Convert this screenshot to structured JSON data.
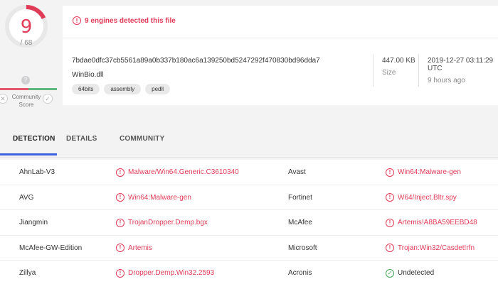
{
  "score": {
    "detections": "9",
    "total": "/ 68",
    "community_label": "Community Score",
    "community_help": "?"
  },
  "summary": {
    "detect_message": "9 engines detected this file",
    "hash": "7bdae0dfc37cb5561a89a0b337b180ac6a139250bd5247292f470830bd96dda7",
    "filename": "WinBio.dll",
    "tags": [
      "64bits",
      "assembly",
      "pedll"
    ],
    "size_value": "447.00 KB",
    "size_label": "Size",
    "date_value": "2019-12-27 03:11:29 UTC",
    "date_relative": "9 hours ago"
  },
  "tabs": [
    {
      "label": "DETECTION",
      "active": true
    },
    {
      "label": "DETAILS",
      "active": false
    },
    {
      "label": "COMMUNITY",
      "active": false
    }
  ],
  "detections": [
    {
      "engine_l": "AhnLab-V3",
      "result_l": "Malware/Win64.Generic.C3610340",
      "engine_r": "Avast",
      "result_r": "Win64:Malware-gen"
    },
    {
      "engine_l": "AVG",
      "result_l": "Win64:Malware-gen",
      "engine_r": "Fortinet",
      "result_r": "W64/Inject.Bltr.spy"
    },
    {
      "engine_l": "Jiangmin",
      "result_l": "TrojanDropper.Demp.bgx",
      "engine_r": "McAfee",
      "result_r": "Artemis!A8BA59EEBD48"
    },
    {
      "engine_l": "McAfee-GW-Edition",
      "result_l": "Artemis",
      "engine_r": "Microsoft",
      "result_r": "Trojan:Win32/Casdet!rfn"
    },
    {
      "engine_l": "Zillya",
      "result_l": "Dropper.Demp.Win32.2593",
      "engine_r": "Acronis",
      "result_r": "Undetected",
      "clean_r": true
    }
  ],
  "colors": {
    "malicious": "#e03b57",
    "clean": "#3fa45a",
    "tab_accent": "#3b61e0"
  },
  "icons": {
    "alert": "alert-circle-icon",
    "clean": "check-circle-icon",
    "vote_down": "close-icon",
    "vote_up": "check-icon"
  }
}
